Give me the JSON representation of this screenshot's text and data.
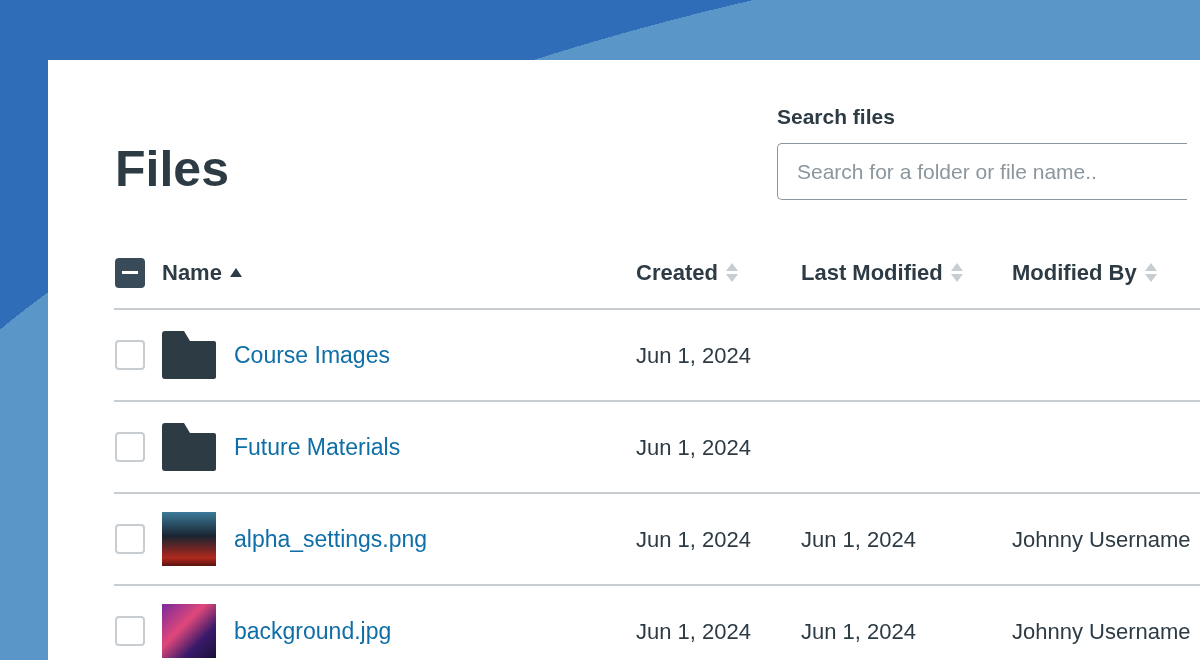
{
  "page": {
    "title": "Files"
  },
  "search": {
    "label": "Search files",
    "placeholder": "Search for a folder or file name.."
  },
  "table": {
    "select_all": {
      "indeterminate": true
    },
    "columns": [
      {
        "label": "Name",
        "sorted": true
      },
      {
        "label": "Created",
        "sorted": false
      },
      {
        "label": "Last Modified",
        "sorted": false
      },
      {
        "label": "Modified By",
        "sorted": false
      }
    ],
    "rows": [
      {
        "kind": "folder",
        "name": "Course Images",
        "created": "Jun 1, 2024",
        "checked": false
      },
      {
        "kind": "folder",
        "name": "Future Materials",
        "created": "Jun 1, 2024",
        "checked": false
      },
      {
        "kind": "image",
        "name": "alpha_settings.png",
        "created": "Jun 1, 2024",
        "last_modified": "Jun 1, 2024",
        "modified_by": "Johnny Username",
        "checked": false
      },
      {
        "kind": "image",
        "name": "background.jpg",
        "created": "Jun 1, 2024",
        "last_modified": "Jun 1, 2024",
        "modified_by": "Johnny Username",
        "checked": false
      }
    ]
  }
}
